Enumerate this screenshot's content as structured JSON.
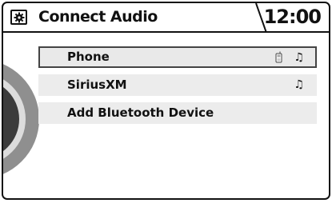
{
  "header": {
    "title": "Connect Audio",
    "time": "12:00"
  },
  "audio_sources": [
    {
      "label": "Phone",
      "selected": true,
      "icons": [
        "phone-icon",
        "music-note-icon"
      ]
    },
    {
      "label": "SiriusXM",
      "selected": false,
      "icons": [
        "music-note-icon"
      ]
    },
    {
      "label": "Add Bluetooth Device",
      "selected": false,
      "icons": []
    }
  ],
  "icons": {
    "music_note": "♫"
  }
}
